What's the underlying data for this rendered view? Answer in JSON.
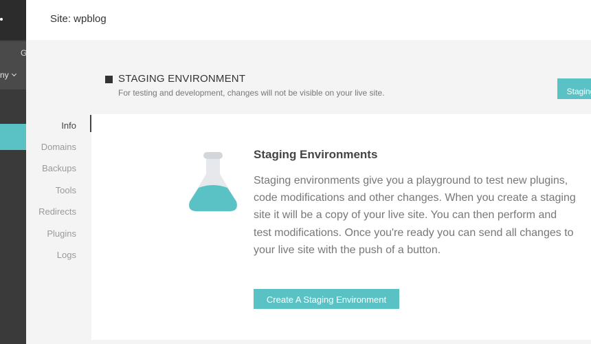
{
  "rail": {
    "glyph": "G",
    "account_label": "ny"
  },
  "header": {
    "site_title": "Site: wpblog"
  },
  "section": {
    "title": "STAGING ENVIRONMENT",
    "subtitle": "For testing and development, changes will not be visible on your live site.",
    "button_label": "Staging"
  },
  "tabs": [
    {
      "label": "Info",
      "active": true
    },
    {
      "label": "Domains",
      "active": false
    },
    {
      "label": "Backups",
      "active": false
    },
    {
      "label": "Tools",
      "active": false
    },
    {
      "label": "Redirects",
      "active": false
    },
    {
      "label": "Plugins",
      "active": false
    },
    {
      "label": "Logs",
      "active": false
    }
  ],
  "card": {
    "icon": "flask-icon",
    "title": "Staging Environments",
    "body": "Staging environments give you a playground to test new plugins, code modifications and other changes. When you create a staging site it will be a copy of your live site. You can then perform and test modifications. Once you're ready you can send all changes to your live site with the push of a button.",
    "button_label": "Create A Staging Environment"
  },
  "colors": {
    "accent": "#5ac2c4",
    "rail": "#3a3a3a"
  }
}
